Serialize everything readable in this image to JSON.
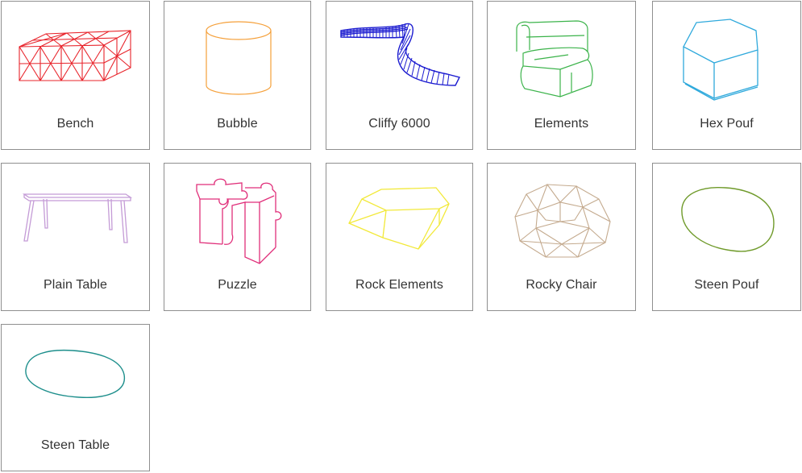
{
  "products": [
    {
      "label": "Bench",
      "icon": "bench-wireframe-icon",
      "color": "#e8242b"
    },
    {
      "label": "Bubble",
      "icon": "bubble-wireframe-icon",
      "color": "#f5a03a"
    },
    {
      "label": "Cliffy 6000",
      "icon": "cliffy-6000-wireframe-icon",
      "color": "#1b1bd0"
    },
    {
      "label": "Elements",
      "icon": "elements-wireframe-icon",
      "color": "#3bb34a"
    },
    {
      "label": "Hex Pouf",
      "icon": "hex-pouf-wireframe-icon",
      "color": "#2fa9dc"
    },
    {
      "label": "Plain Table",
      "icon": "plain-table-wireframe-icon",
      "color": "#c49bd6"
    },
    {
      "label": "Puzzle",
      "icon": "puzzle-wireframe-icon",
      "color": "#e02f7a"
    },
    {
      "label": "Rock Elements",
      "icon": "rock-elements-wireframe-icon",
      "color": "#f2e93a"
    },
    {
      "label": "Rocky Chair",
      "icon": "rocky-chair-wireframe-icon",
      "color": "#c4aa8e"
    },
    {
      "label": "Steen Pouf",
      "icon": "steen-pouf-wireframe-icon",
      "color": "#6f9a2a"
    },
    {
      "label": "Steen Table",
      "icon": "steen-table-wireframe-icon",
      "color": "#1e8f8c"
    }
  ]
}
